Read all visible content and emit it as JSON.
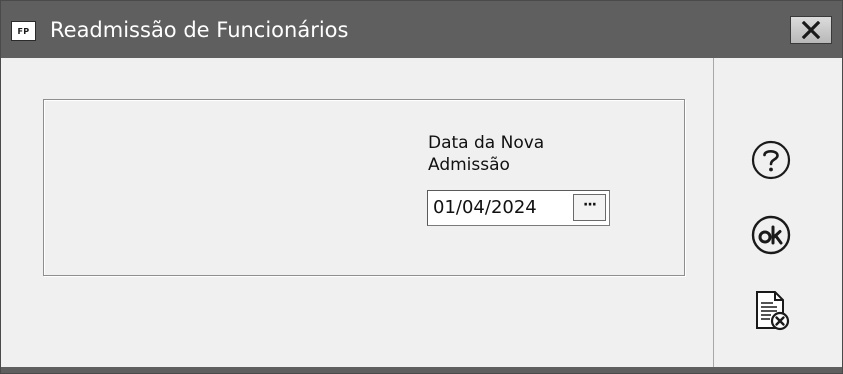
{
  "window": {
    "title": "Readmissão de Funcionários",
    "app_icon_text": "FP",
    "close_icon": "close-x-icon"
  },
  "form": {
    "date_label": "Data da Nova Admissão",
    "date_value": "01/04/2024",
    "picker_label": "···"
  },
  "actions": {
    "help_icon": "help-question-icon",
    "ok_icon": "ok-circle-icon",
    "cancel_icon": "document-cancel-icon"
  },
  "colors": {
    "titlebar": "#5f5f5f",
    "background": "#f0f0f0",
    "title_text": "#ffffff"
  }
}
